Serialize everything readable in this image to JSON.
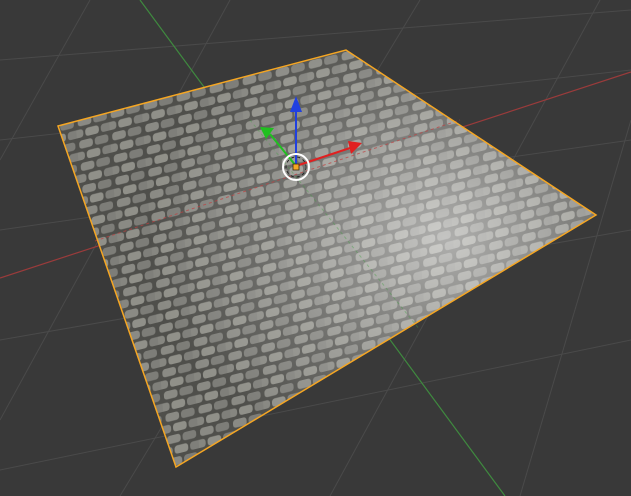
{
  "viewport": {
    "background": "#393939",
    "grid_color": "#4a4a4a"
  },
  "axes": {
    "x_axis_color": "#9a3b3b",
    "y_axis_color": "#3f8a3f"
  },
  "plane": {
    "object": "plane",
    "selected": true,
    "outline_color": "#f5a623",
    "material": "cobblestone"
  },
  "gizmo": {
    "x_color": "#e02020",
    "y_color": "#20c020",
    "z_color": "#2040e0",
    "origin_color": "#f5a623",
    "cursor_color": "#ffffff"
  }
}
